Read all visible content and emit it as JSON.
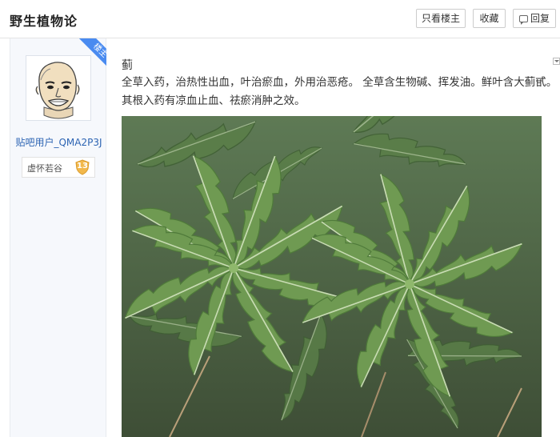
{
  "header": {
    "forum_title": "野生植物论",
    "only_op_label": "只看楼主",
    "favorite_label": "收藏",
    "reply_label": "回复"
  },
  "author": {
    "username": "贴吧用户_QMA2P3J",
    "badge_label": "楼主",
    "level_name": "虚怀若谷",
    "level_number": "13",
    "avatar_icon": "meme-face-avatar"
  },
  "post": {
    "char": "蓟",
    "line1": "全草入药，治热性出血，叶治瘀血，外用治恶疮。 全草含生物碱、挥发油。鲜叶含大蓟甙。",
    "line2": "其根入药有凉血止血、祛瘀消肿之效。",
    "image_subject": "thistle-plant-photo"
  },
  "colors": {
    "link_blue": "#2d64b3",
    "badge_blue": "#4a8bf0",
    "level_gold": "#f2b84b",
    "sidebar_bg": "#f6f8fc"
  }
}
